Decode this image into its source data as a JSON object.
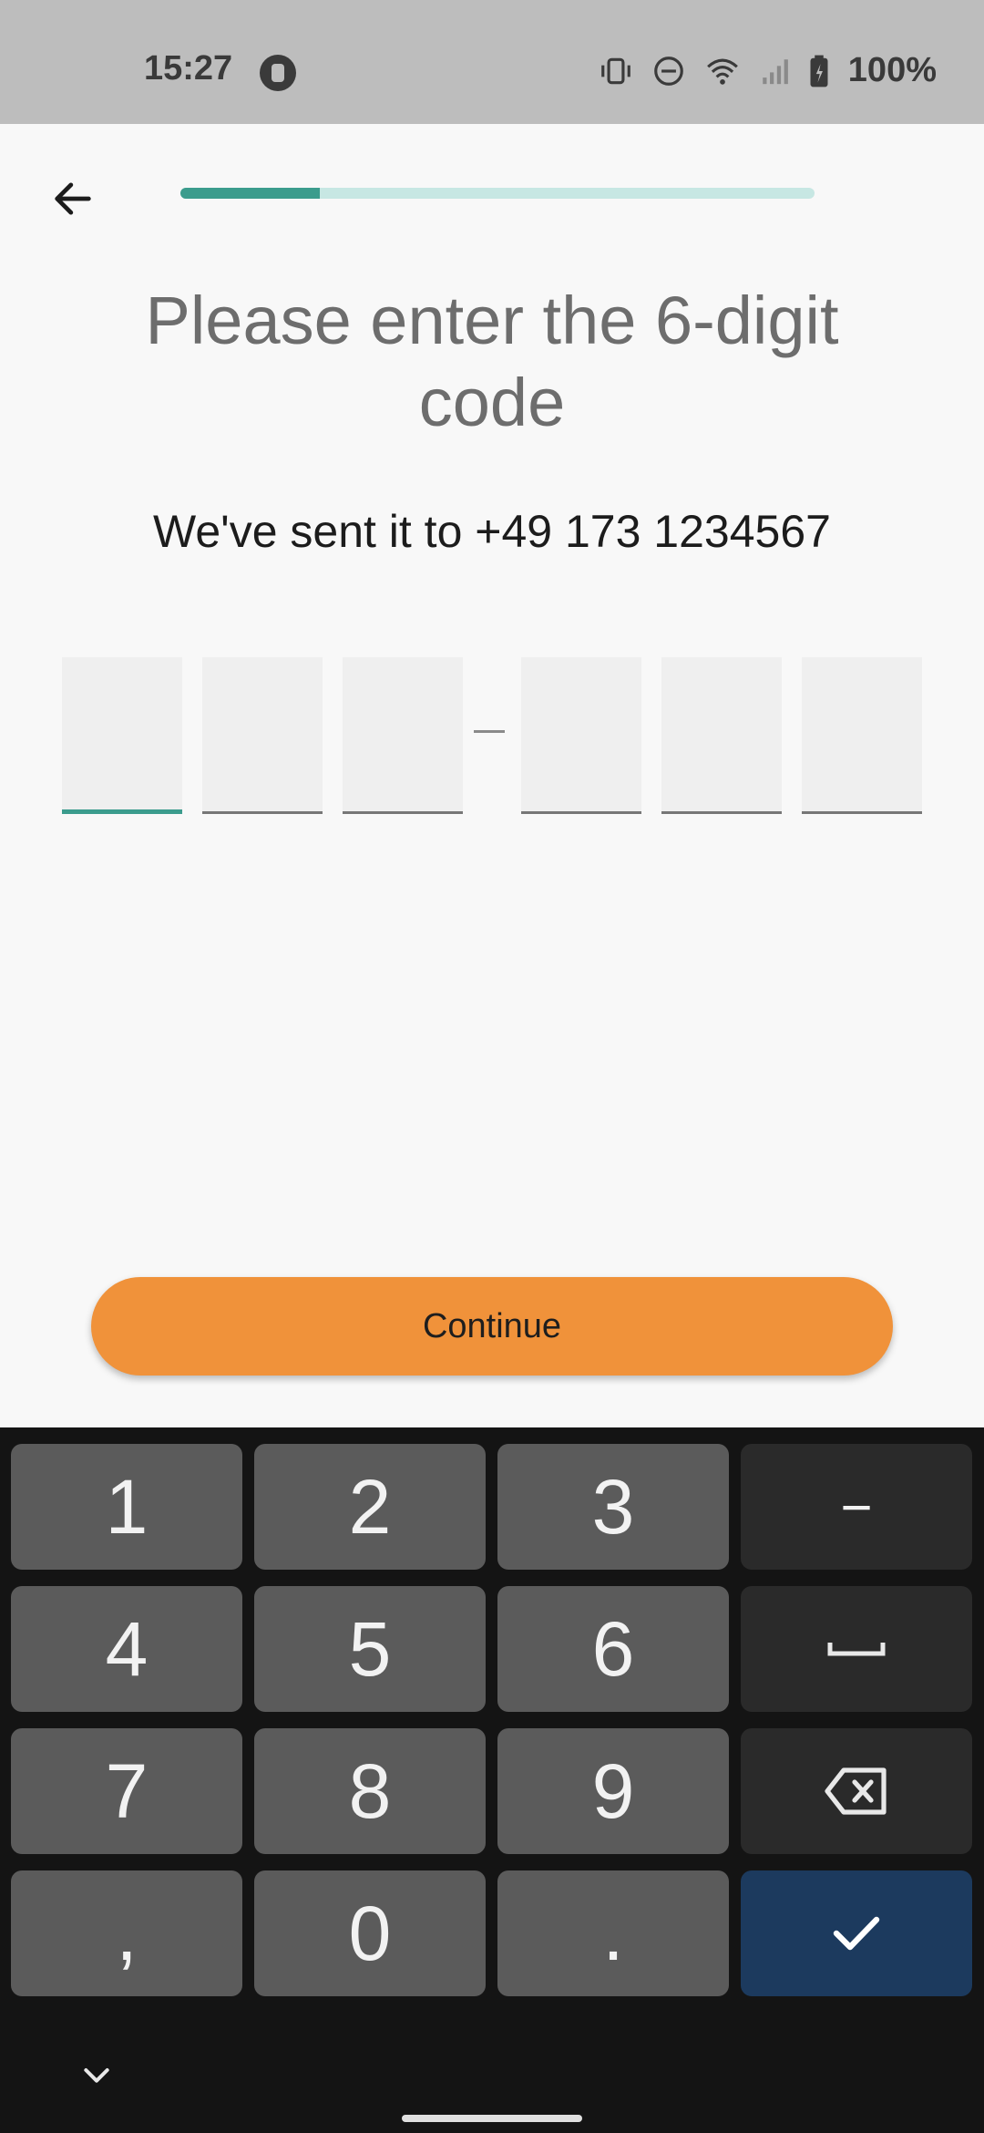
{
  "status_bar": {
    "time": "15:27",
    "battery": "100%"
  },
  "header": {
    "progress_fraction": 0.22
  },
  "content": {
    "title": "Please enter the 6-digit code",
    "subtitle": "We've sent it to +49 173 1234567",
    "code_digits": [
      "",
      "",
      "",
      "",
      "",
      ""
    ]
  },
  "continue_label": "Continue",
  "keyboard": {
    "rows": [
      [
        "1",
        "2",
        "3",
        "−"
      ],
      [
        "4",
        "5",
        "6",
        "space-icon"
      ],
      [
        "7",
        "8",
        "9",
        "backspace-icon"
      ],
      [
        ",",
        "0",
        ".",
        "check-icon"
      ]
    ]
  },
  "colors": {
    "accent": "#3b9c8d",
    "button": "#f0923a",
    "keyboard_enter": "#1c3a5e"
  }
}
